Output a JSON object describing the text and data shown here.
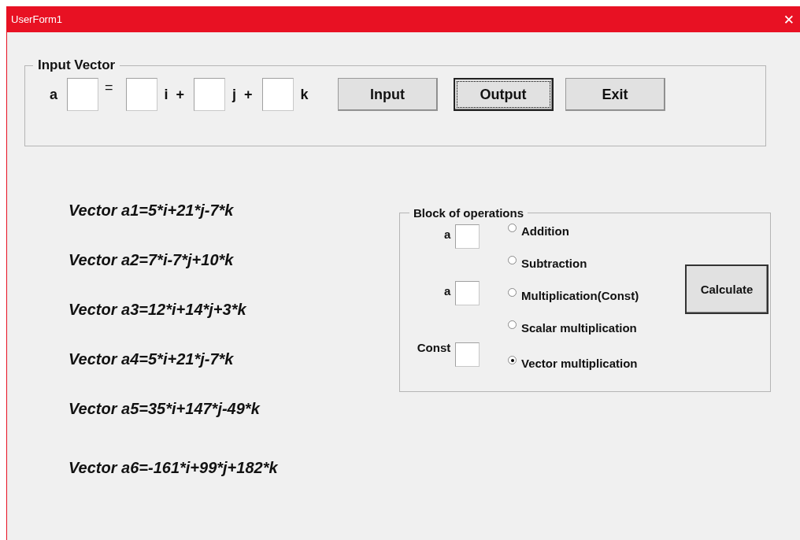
{
  "window": {
    "title": "UserForm1",
    "close": "✕"
  },
  "input_vector": {
    "title": "Input Vector",
    "row": [
      {
        "kind": "label",
        "text": "a"
      },
      {
        "kind": "field"
      },
      {
        "kind": "raised",
        "text": "="
      },
      {
        "kind": "field"
      },
      {
        "kind": "label",
        "text": "i  +"
      },
      {
        "kind": "field"
      },
      {
        "kind": "label",
        "text": "j  +"
      },
      {
        "kind": "field"
      },
      {
        "kind": "label",
        "text": "k"
      }
    ],
    "buttons": [
      {
        "label": "Input",
        "focused": false
      },
      {
        "label": "Output",
        "focused": true
      },
      {
        "label": "Exit",
        "focused": false
      }
    ]
  },
  "vectors": [
    "Vector a1=5*i+21*j-7*k",
    "Vector a2=7*i-7*j+10*k",
    "Vector a3=12*i+14*j+3*k",
    "Vector a4=5*i+21*j-7*k",
    "Vector a5=35*i+147*j-49*k",
    "Vector a6=-161*i+99*j+182*k"
  ],
  "operations": {
    "title": "Block of operations",
    "fields": [
      {
        "label": "a"
      },
      {
        "label": "a"
      },
      {
        "label": "Const"
      }
    ],
    "options": [
      {
        "label": "Addition",
        "selected": false
      },
      {
        "label": "Subtraction",
        "selected": false
      },
      {
        "label": "Multiplication(Const)",
        "selected": false
      },
      {
        "label": "Scalar multiplication",
        "selected": false
      },
      {
        "label": "Vector multiplication",
        "selected": true
      }
    ],
    "button": "Calculate"
  }
}
